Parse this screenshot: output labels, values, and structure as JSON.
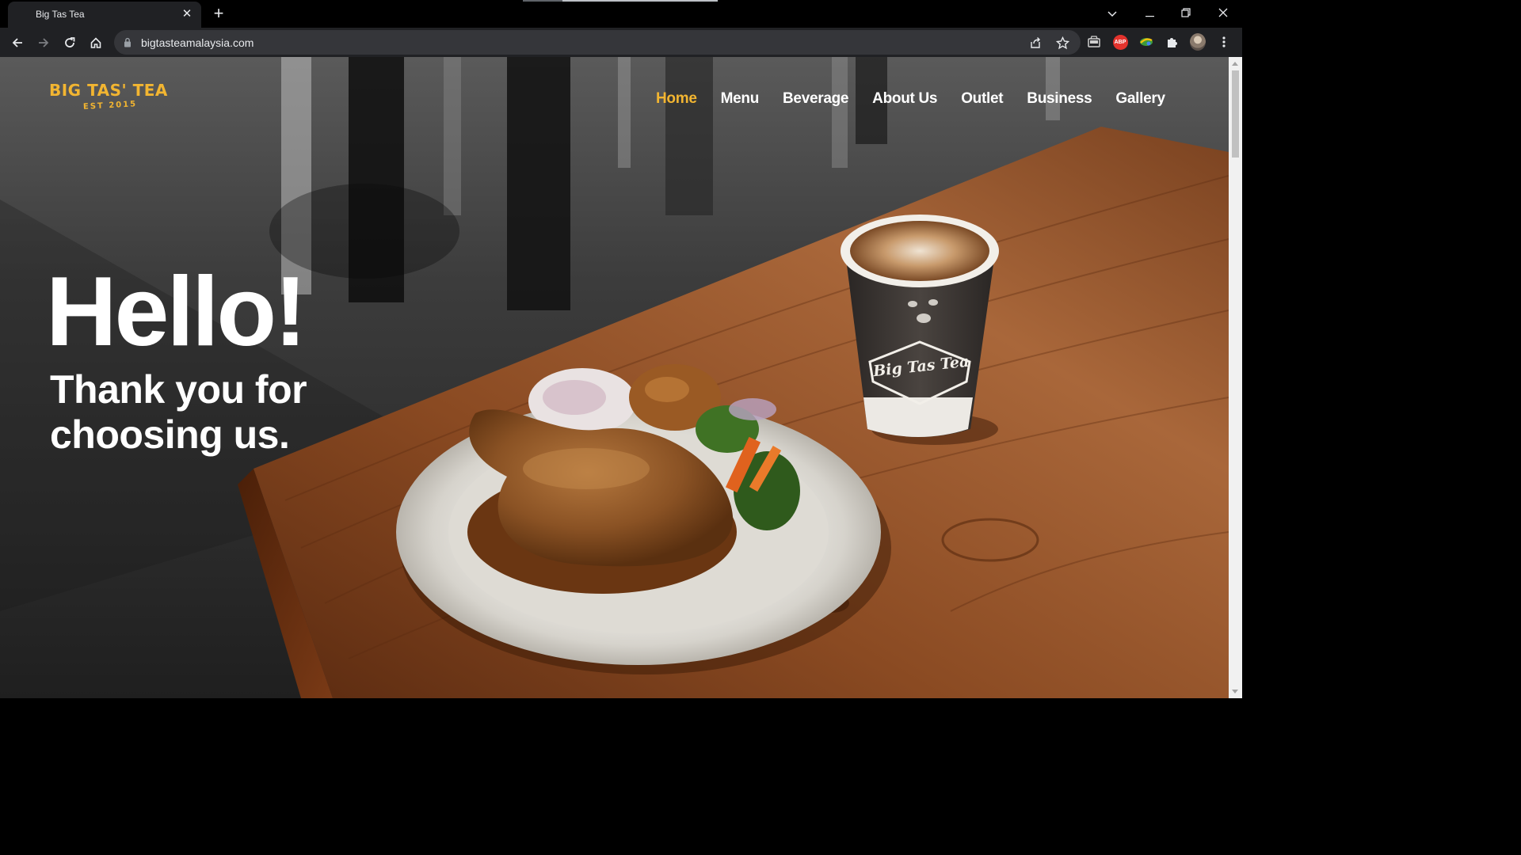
{
  "browser": {
    "tab_title": "Big Tas Tea",
    "url": "bigtasteamalaysia.com",
    "extensions": {
      "abp_label": "ABP"
    }
  },
  "site": {
    "logo": {
      "main": "BIG TAS' TEA",
      "sub": "EST 2015"
    },
    "nav": [
      {
        "label": "Home",
        "active": true
      },
      {
        "label": "Menu",
        "active": false
      },
      {
        "label": "Beverage",
        "active": false
      },
      {
        "label": "About Us",
        "active": false
      },
      {
        "label": "Outlet",
        "active": false
      },
      {
        "label": "Business",
        "active": false
      },
      {
        "label": "Gallery",
        "active": false
      }
    ],
    "hero": {
      "headline": "Hello!",
      "subheadline": "Thank you for choosing us.",
      "cup_brand": "Big Tas Tea"
    }
  },
  "colors": {
    "accent": "#f2b531",
    "chrome_dark": "#202124",
    "omnibox": "#35363a"
  }
}
